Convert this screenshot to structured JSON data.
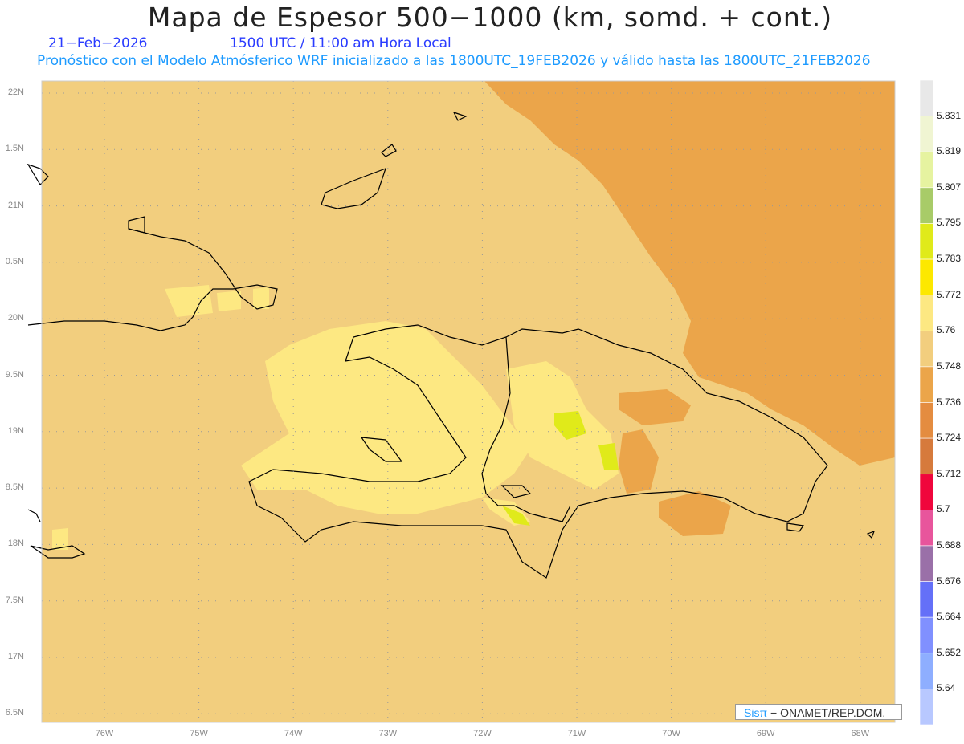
{
  "header": {
    "title": "Mapa de Espesor 500−1000 (km, somd. + cont.)",
    "date": "21−Feb−2026",
    "time": "1500 UTC / 11:00 am Hora Local",
    "model_line": "Pronóstico con el Modelo Atmósferico WRF inicializado a las 1800UTC_19FEB2026 y válido hasta las  1800UTC_21FEB2026"
  },
  "map": {
    "lat_labels": [
      "22N",
      "1.5N",
      "21N",
      "0.5N",
      "20N",
      "9.5N",
      "19N",
      "8.5N",
      "18N",
      "7.5N",
      "17N",
      "6.5N"
    ],
    "lon_labels": [
      "76W",
      "75W",
      "74W",
      "73W",
      "72W",
      "71W",
      "70W",
      "69W",
      "68W"
    ],
    "colors": {
      "background": "#F2CE7E",
      "high": "#EBA54A",
      "low_patch": "#FDE882",
      "peak": "#E0EA1A",
      "coast": "#000000"
    }
  },
  "colorbar": {
    "labels": [
      "5.831",
      "5.819",
      "5.807",
      "5.795",
      "5.783",
      "5.772",
      "5.76",
      "5.748",
      "5.736",
      "5.724",
      "5.712",
      "5.7",
      "5.688",
      "5.676",
      "5.664",
      "5.652",
      "5.64"
    ],
    "colors": [
      "#E8E8E8",
      "#F0F5D2",
      "#E6F3A0",
      "#A8CB68",
      "#E0EA1A",
      "#FDE800",
      "#FDE882",
      "#F2CE7E",
      "#EBA54A",
      "#E48C40",
      "#D67A3C",
      "#F0063C",
      "#E8559C",
      "#9A70A8",
      "#6470F8",
      "#8090FF",
      "#8EAEFF",
      "#B8C8FF"
    ]
  },
  "credit": {
    "brand": "Sisπ",
    "text": " − ONAMET/REP.DOM."
  }
}
